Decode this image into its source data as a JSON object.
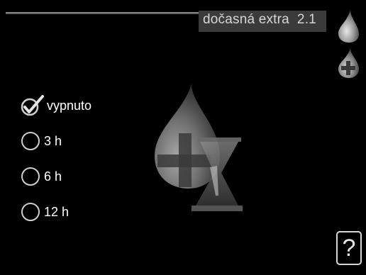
{
  "header": {
    "title": "dočasná extra",
    "menu_number": "2.1"
  },
  "icons": {
    "side_top": "water-drop-icon",
    "side_bottom": "water-drop-plus-icon",
    "hero": "hot-water-drop-plus-hourglass-icon",
    "selected": "checkmark-icon"
  },
  "options": {
    "selected": "vypnuto",
    "items": [
      {
        "label": "vypnuto",
        "selected": true
      },
      {
        "label": "3 h",
        "selected": false
      },
      {
        "label": "6 h",
        "selected": false
      },
      {
        "label": "12 h",
        "selected": false
      }
    ]
  },
  "help": {
    "label": "?"
  },
  "colors": {
    "background": "#000000",
    "title_bg": "#3b3b3b",
    "title_text": "#d6d6d6",
    "text": "#ffffff"
  }
}
